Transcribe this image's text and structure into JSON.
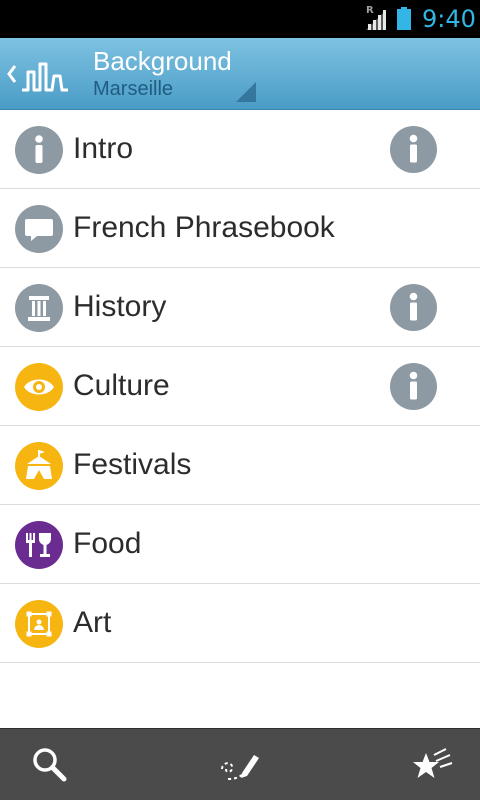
{
  "status_bar": {
    "time": "9:40",
    "roaming_indicator": "R",
    "icons": [
      "signal-icon",
      "battery-icon"
    ]
  },
  "action_bar": {
    "title": "Background",
    "subtitle": "Marseille",
    "icons": [
      "up-caret-icon",
      "app-logo-icon",
      "spinner-corner-icon"
    ]
  },
  "list": {
    "items": [
      {
        "label": "Intro",
        "icon": "info-icon",
        "icon_color": "#8e9aa3",
        "has_info": true
      },
      {
        "label": "French Phrasebook",
        "icon": "speech-bubble-icon",
        "icon_color": "#8e9aa3",
        "has_info": false
      },
      {
        "label": "History",
        "icon": "column-icon",
        "icon_color": "#8e9aa3",
        "has_info": true
      },
      {
        "label": "Culture",
        "icon": "eye-icon",
        "icon_color": "#f6b510",
        "has_info": true
      },
      {
        "label": "Festivals",
        "icon": "tent-icon",
        "icon_color": "#f6b510",
        "has_info": false
      },
      {
        "label": "Food",
        "icon": "fork-wine-icon",
        "icon_color": "#6b2c91",
        "has_info": false
      },
      {
        "label": "Art",
        "icon": "picture-frame-icon",
        "icon_color": "#f6b510",
        "has_info": false
      }
    ]
  },
  "bottom_bar": {
    "icons": [
      "search-icon",
      "note-pencil-icon",
      "favorites-star-icon"
    ]
  },
  "colors": {
    "action_bar_top": "#7ec2e2",
    "action_bar_bottom": "#4a9cc6",
    "clock": "#33b5e5",
    "bottom_bar": "#4b4b4b"
  }
}
